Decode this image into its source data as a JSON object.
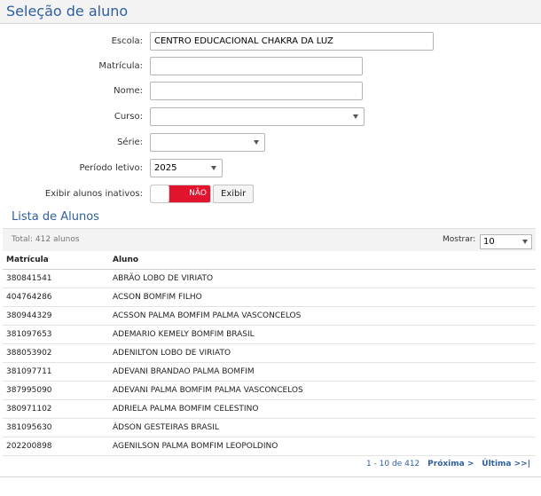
{
  "header": {
    "title": "Seleção de aluno"
  },
  "form": {
    "escola": {
      "label": "Escola:",
      "value": "CENTRO EDUCACIONAL CHAKRA DA LUZ"
    },
    "matricula": {
      "label": "Matrícula:",
      "value": ""
    },
    "nome": {
      "label": "Nome:",
      "value": ""
    },
    "curso": {
      "label": "Curso:",
      "value": ""
    },
    "serie": {
      "label": "Série:",
      "value": ""
    },
    "periodo": {
      "label": "Período letivo:",
      "value": "2025"
    },
    "inativos": {
      "label": "Exibir alunos inativos:",
      "state": "NÃO",
      "button": "Exibir"
    }
  },
  "list": {
    "title": "Lista de Alunos",
    "total": "Total: 412 alunos",
    "mostrar_label": "Mostrar:",
    "mostrar_value": "10",
    "columns": [
      "Matrícula",
      "Aluno"
    ],
    "rows": [
      [
        "380841541",
        "ABRÃO LOBO DE VIRIATO"
      ],
      [
        "404764286",
        "ACSON BOMFIM FILHO"
      ],
      [
        "380944329",
        "ACSSON PALMA BOMFIM PALMA VASCONCELOS"
      ],
      [
        "381097653",
        "ADEMARIO KEMELY BOMFIM BRASIL"
      ],
      [
        "388053902",
        "ADENILTON LOBO DE VIRIATO"
      ],
      [
        "381097711",
        "ADEVANI BRANDAO PALMA BOMFIM"
      ],
      [
        "387995090",
        "ADEVANI PALMA BOMFIM PALMA VASCONCELOS"
      ],
      [
        "380971102",
        "ADRIELA PALMA BOMFIM CELESTINO"
      ],
      [
        "381095630",
        "ÁDSON GESTEIRAS BRASIL"
      ],
      [
        "202200898",
        "AGENILSON PALMA BOMFIM LEOPOLDINO"
      ]
    ]
  },
  "pager": {
    "range": "1 - 10 de 412",
    "next": "Próxima >",
    "last": "Última >>|"
  }
}
